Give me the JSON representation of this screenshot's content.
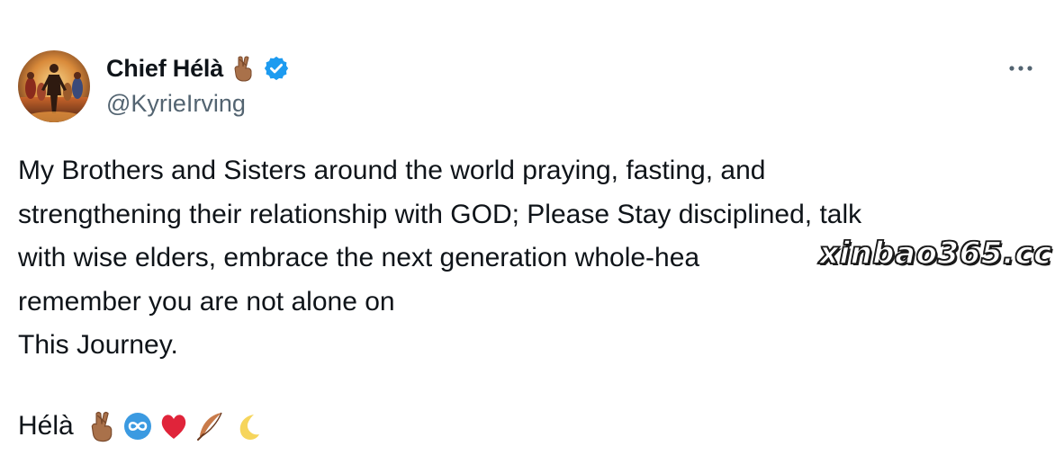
{
  "tweet": {
    "author": {
      "display_name": "Chief Hélà",
      "handle": "@KyrieIrving",
      "verified": true,
      "name_emoji": "crossed-fingers-emoji"
    },
    "more_icon": "more-horizontal-icon",
    "text_lines": [
      "My Brothers and Sisters around the world praying, fasting, and",
      "strengthening their relationship with GOD; Please Stay disciplined, talk",
      "with wise elders, embrace the next generation whole-hea",
      "remember you are not alone on",
      "This Journey."
    ],
    "signoff": {
      "name": "Hélà",
      "emojis": [
        "crossed-fingers-emoji",
        "infinity-emoji",
        "red-heart-emoji",
        "feather-emoji",
        "crescent-moon-emoji"
      ]
    },
    "watermark": "xinbao365.cc"
  },
  "colors": {
    "text": "#0f1419",
    "secondary": "#536471",
    "verified_blue": "#1d9bf0",
    "heart_red": "#e0243a"
  }
}
